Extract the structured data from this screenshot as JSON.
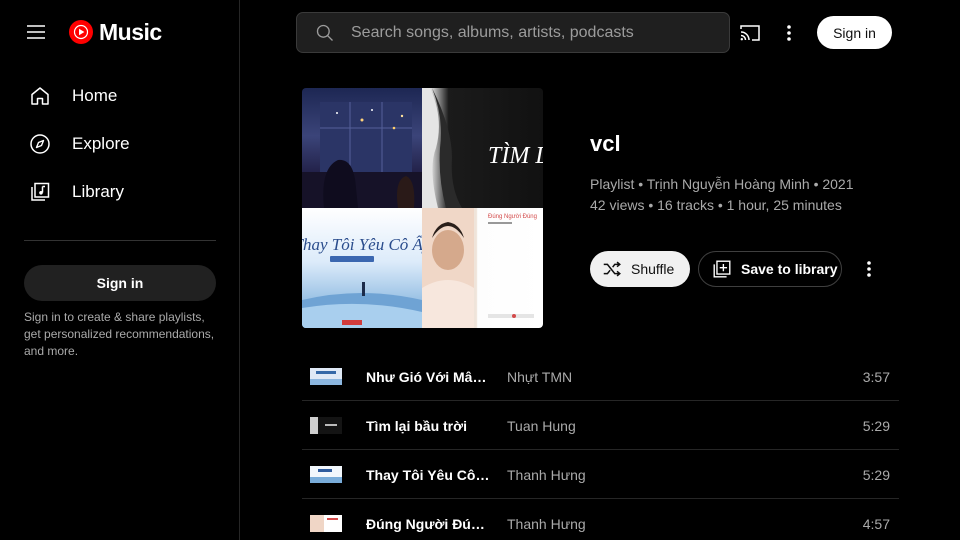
{
  "app": {
    "logo_text": "Music"
  },
  "search": {
    "placeholder": "Search songs, albums, artists, podcasts"
  },
  "topbar": {
    "sign_in_label": "Sign in"
  },
  "sidebar": {
    "items": [
      {
        "label": "Home",
        "icon": "home-icon"
      },
      {
        "label": "Explore",
        "icon": "compass-icon"
      },
      {
        "label": "Library",
        "icon": "library-icon"
      }
    ],
    "sign_in_label": "Sign in",
    "note": "Sign in to create & share playlists, get personalized recommendations, and more."
  },
  "playlist": {
    "title": "vcl",
    "meta_line1": "Playlist • Trịnh Nguyễn Hoàng Minh • 2021",
    "meta_line2": "42 views • 16 tracks • 1 hour, 25 minutes",
    "shuffle_label": "Shuffle",
    "save_label": "Save to library"
  },
  "cover_text": {
    "tile2": "TÌM LẠ",
    "tile3": "Thay Tôi Yêu Cô Ấy",
    "tile4": "Đúng Người Đúng"
  },
  "tracks": [
    {
      "title": "Như Gió Với Mây (feat. VVX)",
      "artist": "Nhựt TMN",
      "duration": "3:57"
    },
    {
      "title": "Tìm lại bầu trời",
      "artist": "Tuan Hung",
      "duration": "5:29"
    },
    {
      "title": "Thay Tôi Yêu Cô Ấy",
      "artist": "Thanh Hưng",
      "duration": "5:29"
    },
    {
      "title": "Đúng Người Đúng Thời Điểm",
      "artist": "Thanh Hưng",
      "duration": "4:57"
    }
  ],
  "colors": {
    "brand_red": "#ff0000",
    "background": "#000000",
    "muted_text": "#aaaaaa"
  }
}
